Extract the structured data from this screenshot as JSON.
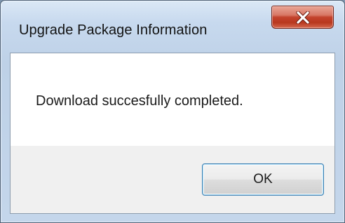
{
  "dialog": {
    "title": "Upgrade Package Information",
    "message": "Download succesfully completed.",
    "ok_label": "OK",
    "close_icon": "close-icon"
  },
  "colors": {
    "close_button": "#c4432e",
    "dialog_body": "#ffffff",
    "footer": "#f0f0f0",
    "ok_border": "#3c7fb1"
  }
}
